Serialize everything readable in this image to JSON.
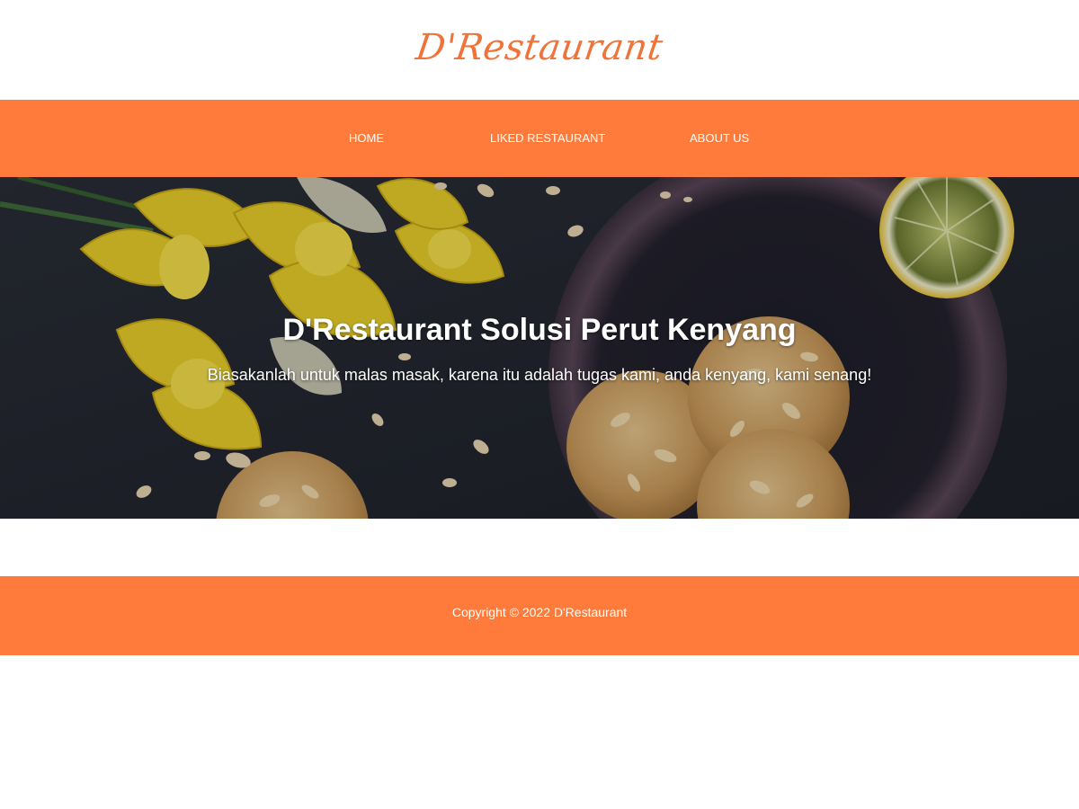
{
  "theme": {
    "accent": "#ff7b3b",
    "logo_color": "#f0733a",
    "text_on_accent": "#ffffff"
  },
  "header": {
    "brand": "D'Restaurant"
  },
  "nav": {
    "items": [
      {
        "label": "HOME"
      },
      {
        "label": "LIKED RESTAURANT"
      },
      {
        "label": "ABOUT US"
      }
    ]
  },
  "hero": {
    "title": "D'Restaurant Solusi Perut Kenyang",
    "tagline": "Biasakanlah untuk malas masak, karena itu adalah tugas kami, anda kenyang, kami senang!",
    "image_subject": "almond cookies in a dark bowl with yellow daffodils and a lemon slice"
  },
  "footer": {
    "copyright": "Copyright © 2022 D'Restaurant"
  }
}
